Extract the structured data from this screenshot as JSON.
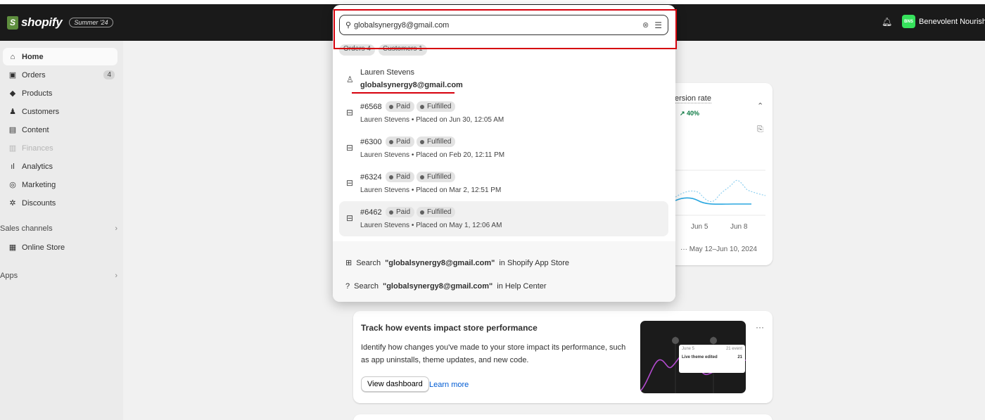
{
  "topbar": {
    "brand": "shopify",
    "brand_icon": "S",
    "edition": "Summer '24",
    "bell_icon": "bell-icon",
    "avatar_initials": "BNS",
    "user_name": "Benevolent Nourishm"
  },
  "sidebar": {
    "items": [
      {
        "label": "Home",
        "icon": "home-icon",
        "glyph": "⌂"
      },
      {
        "label": "Orders",
        "icon": "inbox-icon",
        "glyph": "▣",
        "badge": "4"
      },
      {
        "label": "Products",
        "icon": "tag-icon",
        "glyph": "◆"
      },
      {
        "label": "Customers",
        "icon": "person-icon",
        "glyph": "♟"
      },
      {
        "label": "Content",
        "icon": "monitor-icon",
        "glyph": "▤"
      },
      {
        "label": "Finances",
        "icon": "bank-icon",
        "glyph": "▥"
      },
      {
        "label": "Analytics",
        "icon": "bar-chart-icon",
        "glyph": "ıl"
      },
      {
        "label": "Marketing",
        "icon": "target-icon",
        "glyph": "◎"
      },
      {
        "label": "Discounts",
        "icon": "discount-icon",
        "glyph": "✲"
      }
    ],
    "sales_channels_label": "Sales channels",
    "online_store_label": "Online Store",
    "online_store_glyph": "▦",
    "apps_label": "Apps",
    "chevron": "›"
  },
  "search": {
    "value": "globalsynergy8@gmail.com",
    "search_glyph": "⚲",
    "clear_glyph": "⊗",
    "filter_glyph": "☰",
    "chips": [
      "Orders 4",
      "Customers 1"
    ],
    "customer": {
      "name": "Lauren Stevens",
      "email": "globalsynergy8@gmail.com",
      "glyph": "♙"
    },
    "orders": [
      {
        "number": "#6568",
        "paid": "Paid",
        "fulfilled": "Fulfilled",
        "meta": "Lauren Stevens • Placed on Jun 30, 12:05 AM"
      },
      {
        "number": "#6300",
        "paid": "Paid",
        "fulfilled": "Fulfilled",
        "meta": "Lauren Stevens • Placed on Feb 20, 12:11 PM"
      },
      {
        "number": "#6324",
        "paid": "Paid",
        "fulfilled": "Fulfilled",
        "meta": "Lauren Stevens • Placed on Mar 2, 12:51 PM"
      },
      {
        "number": "#6462",
        "paid": "Paid",
        "fulfilled": "Fulfilled",
        "meta": "Lauren Stevens • Placed on May 1, 12:06 AM"
      }
    ],
    "order_glyph": "⊟",
    "app_store": {
      "prefix": "Search",
      "query": "\"globalsynergy8@gmail.com\"",
      "suffix": "in Shopify App Store",
      "glyph": "⊞"
    },
    "help_center": {
      "prefix": "Search",
      "query": "\"globalsynergy8@gmail.com\"",
      "suffix": "in Help Center",
      "glyph": "?"
    }
  },
  "conversion_card": {
    "title": "ersion rate",
    "delta": "↗ 40%",
    "chevron": "⌃",
    "icon_glyph": "⎘",
    "ticks": [
      "Jun 5",
      "Jun 8"
    ],
    "range": "··· May 12–Jun 10, 2024"
  },
  "events_card": {
    "title": "Track how events impact store performance",
    "description": "Identify how changes you've made to your store impact its performance, such as app uninstalls, theme updates, and new code.",
    "button": "View dashboard",
    "link": "Learn more",
    "menu": "···",
    "tooltip_date": "June 5",
    "tooltip_count": "21 event",
    "tooltip_label": "Live theme edited",
    "tooltip_value": "21"
  },
  "colors": {
    "topbar": "#1a1a1a",
    "highlight": "#d6000c",
    "link": "#005bd3",
    "delta": "#0c7a43",
    "chart_line": "#2aa7e0"
  }
}
